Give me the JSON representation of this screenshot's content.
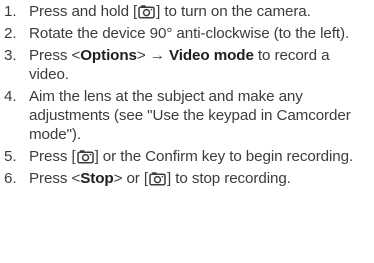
{
  "steps": [
    {
      "num": "1.",
      "parts": [
        {
          "t": "Press and hold ["
        },
        {
          "icon": "camera-key-icon"
        },
        {
          "t": "] to turn on the camera."
        }
      ]
    },
    {
      "num": "2.",
      "parts": [
        {
          "t": "Rotate the device 90° anti-clockwise (to the left)."
        }
      ]
    },
    {
      "num": "3.",
      "parts": [
        {
          "t": "Press <"
        },
        {
          "b": "Options"
        },
        {
          "t": "> → "
        },
        {
          "b": "Video mode"
        },
        {
          "t": " to record a video."
        }
      ]
    },
    {
      "num": "4.",
      "parts": [
        {
          "t": "Aim the lens at the subject and make any adjustments (see \"Use the keypad in Camcorder mode\")."
        }
      ]
    },
    {
      "num": "5.",
      "parts": [
        {
          "t": "Press ["
        },
        {
          "icon": "camera-key-icon"
        },
        {
          "t": "] or the Confirm key to begin recording."
        }
      ]
    },
    {
      "num": "6.",
      "parts": [
        {
          "t": "Press <"
        },
        {
          "b": "Stop"
        },
        {
          "t": "> or ["
        },
        {
          "icon": "camera-key-icon"
        },
        {
          "t": "] to stop recording."
        }
      ]
    }
  ]
}
